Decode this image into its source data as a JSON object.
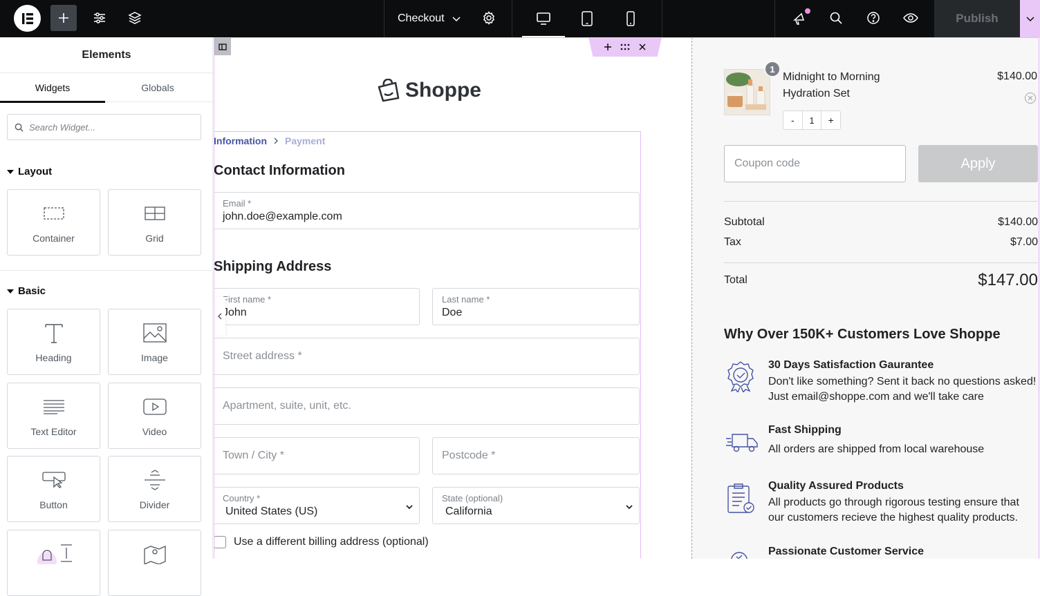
{
  "topbar": {
    "document_title": "Checkout",
    "publish_label": "Publish"
  },
  "panel": {
    "title": "Elements",
    "tabs": [
      "Widgets",
      "Globals"
    ],
    "search_placeholder": "Search Widget...",
    "sections": [
      {
        "title": "Layout",
        "widgets": [
          "Container",
          "Grid"
        ]
      },
      {
        "title": "Basic",
        "widgets": [
          "Heading",
          "Image",
          "Text Editor",
          "Video",
          "Button",
          "Divider"
        ]
      }
    ]
  },
  "checkout": {
    "brand": "Shoppe",
    "breadcrumb": [
      "Information",
      "Payment"
    ],
    "contact_heading": "Contact Information",
    "email": {
      "label": "Email *",
      "value": "john.doe@example.com"
    },
    "shipping_heading": "Shipping Address",
    "first_name": {
      "label": "First name *",
      "value": "John"
    },
    "last_name": {
      "label": "Last name *",
      "value": "Doe"
    },
    "street_placeholder": "Street address *",
    "apartment_placeholder": "Apartment, suite, unit, etc.",
    "city_placeholder": "Town / City *",
    "postcode_placeholder": "Postcode *",
    "country": {
      "label": "Country *",
      "value": "United States (US)"
    },
    "state": {
      "label": "State (optional)",
      "value": "California"
    },
    "billing_checkbox_label": "Use a different billing address (optional)"
  },
  "summary": {
    "product": {
      "name": "Midnight to Morning Hydration Set",
      "price": "$140.00",
      "quantity_badge": "1",
      "quantity": "1",
      "minus": "-",
      "plus": "+"
    },
    "coupon_placeholder": "Coupon code",
    "apply_label": "Apply",
    "subtotal_label": "Subtotal",
    "subtotal_value": "$140.00",
    "tax_label": "Tax",
    "tax_value": "$7.00",
    "total_label": "Total",
    "total_value": "$147.00",
    "why_heading": "Why Over 150K+ Customers Love Shoppe",
    "features": [
      {
        "icon": "badge-check-icon",
        "title": "30 Days Satisfaction Gaurantee",
        "desc": "Don't like something? Sent it back no questions asked! Just email@shoppe.com and we'll take care"
      },
      {
        "icon": "truck-icon",
        "title": "Fast Shipping",
        "desc": "All orders are shipped from local warehouse"
      },
      {
        "icon": "clipboard-check-icon",
        "title": "Quality Assured Products",
        "desc": "All products go through rigorous testing ensure that our customers recieve the highest quality products."
      },
      {
        "icon": "support-icon",
        "title": "Passionate Customer Service",
        "desc": ""
      }
    ]
  },
  "colors": {
    "topbar_bg": "#0c0d0e",
    "accent_pink": "#e9c8f7",
    "breadcrumb_active": "#4654a3",
    "icon_blue": "#4654a3"
  }
}
